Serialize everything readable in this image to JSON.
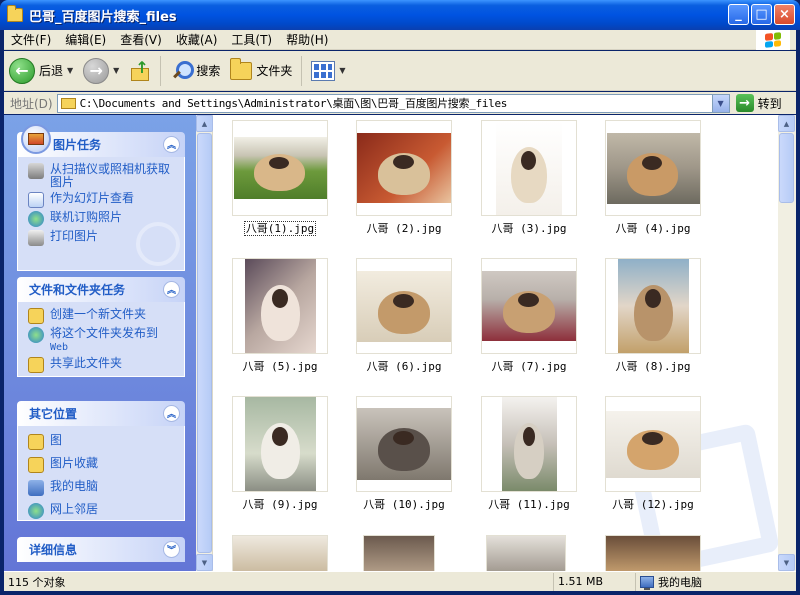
{
  "window": {
    "title": "巴哥_百度图片搜索_files",
    "minimize": "_",
    "maximize": "□",
    "close": "×"
  },
  "menubar": {
    "items": [
      "文件(F)",
      "编辑(E)",
      "查看(V)",
      "收藏(A)",
      "工具(T)",
      "帮助(H)"
    ]
  },
  "toolbar": {
    "back_label": "后退",
    "back_glyph": "←",
    "forward_glyph": "→",
    "up_glyph": "↑",
    "search_label": "搜索",
    "folders_label": "文件夹",
    "dropdown_glyph": "▼"
  },
  "address": {
    "label": "地址(D)",
    "path": "C:\\Documents and Settings\\Administrator\\桌面\\图\\巴哥_百度图片搜索_files",
    "go_label": "转到",
    "go_glyph": "→"
  },
  "taskpane": {
    "chevron_glyph": "︽",
    "picture_tasks": {
      "title": "图片任务",
      "items": [
        "从扫描仪或照相机获取图片",
        "作为幻灯片查看",
        "联机订购照片",
        "打印图片"
      ]
    },
    "file_tasks": {
      "title": "文件和文件夹任务",
      "items": [
        "创建一个新文件夹",
        "将这个文件夹发布到",
        "共享此文件夹"
      ],
      "publish_suffix": "Web"
    },
    "other_places": {
      "title": "其它位置",
      "items": [
        "图",
        "图片收藏",
        "我的电脑",
        "网上邻居"
      ]
    },
    "details": {
      "title": "详细信息"
    }
  },
  "scrollbar": {
    "up_glyph": "▲",
    "down_glyph": "▼"
  },
  "files": [
    {
      "name": "八哥(1).jpg",
      "selected": true
    },
    {
      "name": "八哥 (2).jpg"
    },
    {
      "name": "八哥 (3).jpg"
    },
    {
      "name": "八哥 (4).jpg"
    },
    {
      "name": "八哥 (5).jpg"
    },
    {
      "name": "八哥 (6).jpg"
    },
    {
      "name": "八哥 (7).jpg"
    },
    {
      "name": "八哥 (8).jpg"
    },
    {
      "name": "八哥 (9).jpg"
    },
    {
      "name": "八哥 (10).jpg"
    },
    {
      "name": "八哥 (11).jpg"
    },
    {
      "name": "八哥 (12).jpg"
    }
  ],
  "statusbar": {
    "count": "115 个对象",
    "size": "1.51 MB",
    "location": "我的电脑"
  },
  "colors": {
    "titlebar": "#0053e1",
    "taskpane": "#6d8ee0",
    "panel_title": "#215dc6",
    "chrome": "#ece9d8"
  }
}
